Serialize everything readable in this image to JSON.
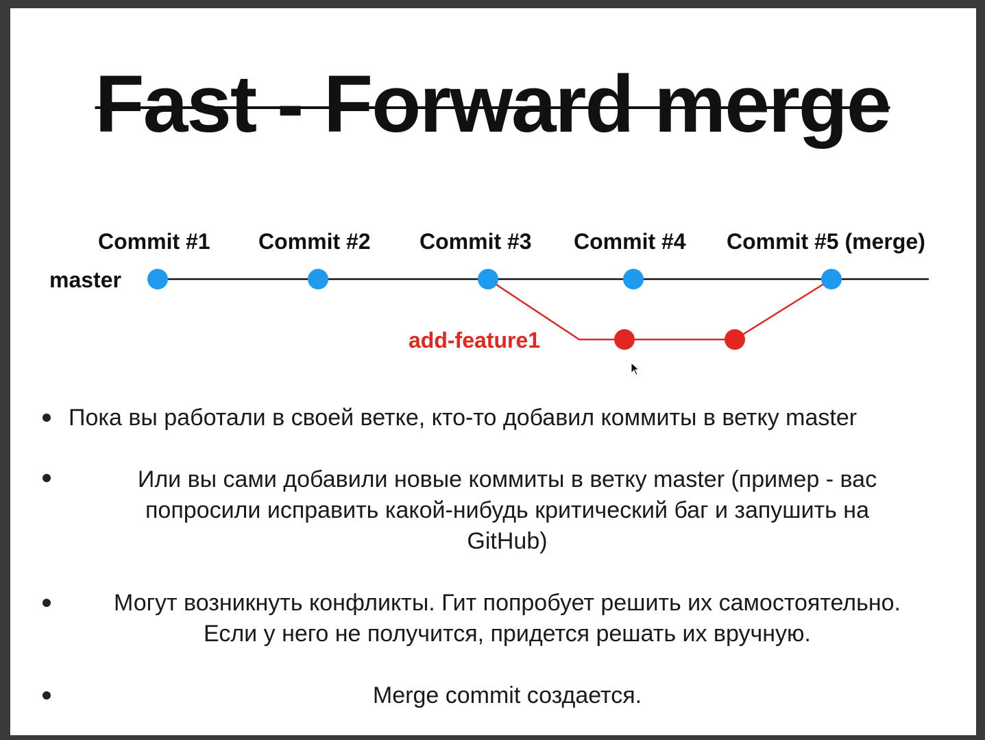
{
  "slide": {
    "title": "Fast - Forward merge"
  },
  "diagram": {
    "master_label": "master",
    "branch_label": "add-feature1",
    "commits": [
      {
        "label": "Commit #1"
      },
      {
        "label": "Commit #2"
      },
      {
        "label": "Commit #3"
      },
      {
        "label": "Commit #4"
      },
      {
        "label": "Commit #5 (merge)"
      }
    ],
    "colors": {
      "master_line": "#111111",
      "master_commit": "#1e9bf0",
      "branch": "#e3261f"
    }
  },
  "bullets": [
    {
      "text": "Пока вы работали в своей ветке, кто-то добавил коммиты в ветку master"
    },
    {
      "lines": [
        "Или вы сами добавили новые коммиты в ветку master (пример - вас",
        "попросили исправить какой-нибудь критический баг и запушить на",
        "GitHub)"
      ]
    },
    {
      "lines": [
        "Могут возникнуть конфликты. Гит попробует решить их самостоятельно.",
        "Если у него не получится, придется решать их вручную."
      ]
    },
    {
      "text": "Merge commit создается."
    }
  ]
}
